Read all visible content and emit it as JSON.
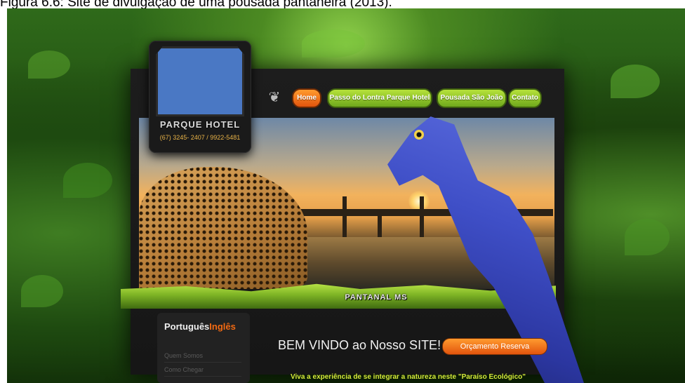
{
  "caption": "Figura 6.6: Site de divulgação de uma pousada pantaneira (2013).",
  "logo": {
    "title": "PARQUE HOTEL",
    "phone": "(67) 3245- 2407 / 9922-5481"
  },
  "nav": {
    "items": [
      {
        "label": "Home",
        "active": true
      },
      {
        "label": "Passo do Lontra Parque Hotel",
        "active": false
      },
      {
        "label": "Pousada São João",
        "active": false
      },
      {
        "label": "Contato",
        "active": false
      }
    ]
  },
  "banner": {
    "label": "PANTANAL MS"
  },
  "sidebar": {
    "lang_pt": "Português",
    "lang_en": "Inglês",
    "links": [
      "Quem Somos",
      "Como Chegar"
    ]
  },
  "main": {
    "welcome": "BEM VINDO ao Nosso SITE!",
    "reserve_button": "Orçamento Reserva",
    "tagline": "Viva a experiência de se integrar a natureza neste \"Paraíso Ecológico\""
  },
  "colors": {
    "accent_orange": "#e2540d",
    "nav_green": "#8cc22a",
    "tagline": "#d6ea3b"
  }
}
